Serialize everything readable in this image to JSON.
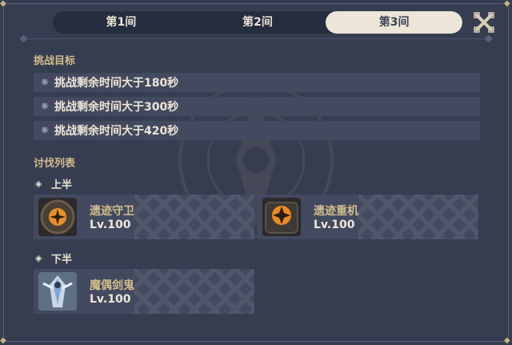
{
  "tabs": [
    {
      "label": "第1间"
    },
    {
      "label": "第2间"
    },
    {
      "label": "第3间"
    }
  ],
  "active_tab_index": 2,
  "close_icon": "close-x-icon",
  "colors": {
    "panel_bg": "#363d51",
    "accent_gold": "#d2bc8e",
    "text_light": "#ece5d8",
    "active_tab_bg": "#ece5d8"
  },
  "goals": {
    "title": "挑战目标",
    "items": [
      {
        "icon": "star-icon",
        "text": "挑战剩余时间大于180秒"
      },
      {
        "icon": "star-icon",
        "text": "挑战剩余时间大于300秒"
      },
      {
        "icon": "star-icon",
        "text": "挑战剩余时间大于420秒"
      }
    ]
  },
  "enemies": {
    "title": "讨伐列表",
    "first_half": {
      "label": "上半",
      "list": [
        {
          "name": "遗迹守卫",
          "level": "Lv.100",
          "icon": "ruin-guard-portrait"
        },
        {
          "name": "遗迹重机",
          "level": "Lv.100",
          "icon": "ruin-grader-portrait"
        }
      ]
    },
    "second_half": {
      "label": "下半",
      "list": [
        {
          "name": "魔偶剑鬼",
          "level": "Lv.100",
          "icon": "maguu-kenki-portrait"
        }
      ]
    }
  }
}
